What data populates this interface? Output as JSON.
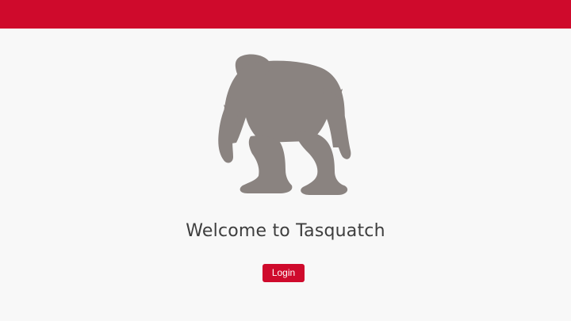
{
  "header": {
    "accent_color": "#cf0a2c"
  },
  "hero": {
    "logo_icon": "sasquatch-silhouette-icon",
    "logo_color": "#8a8380",
    "title": "Welcome to Tasquatch"
  },
  "actions": {
    "login_label": "Login",
    "login_color": "#cf0a2c"
  }
}
